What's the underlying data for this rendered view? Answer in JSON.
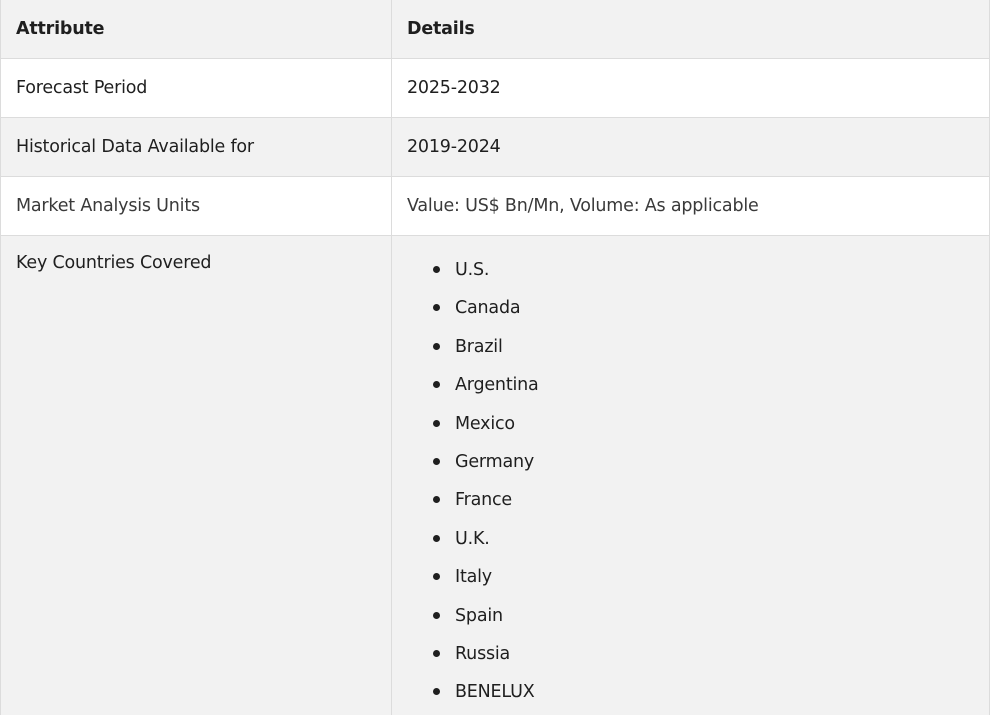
{
  "header": {
    "attribute": "Attribute",
    "details": "Details"
  },
  "rows": [
    {
      "attribute": "Forecast Period",
      "details": "2025-2032"
    },
    {
      "attribute": "Historical Data Available for",
      "details": "2019-2024"
    },
    {
      "attribute": "Market Analysis Units",
      "details": "Value: US$ Bn/Mn, Volume: As applicable"
    }
  ],
  "countries_row": {
    "attribute": "Key Countries Covered",
    "items": [
      "U.S.",
      "Canada",
      "Brazil",
      "Argentina",
      "Mexico",
      "Germany",
      "France",
      "U.K.",
      "Italy",
      "Spain",
      "Russia",
      "BENELUX"
    ]
  }
}
